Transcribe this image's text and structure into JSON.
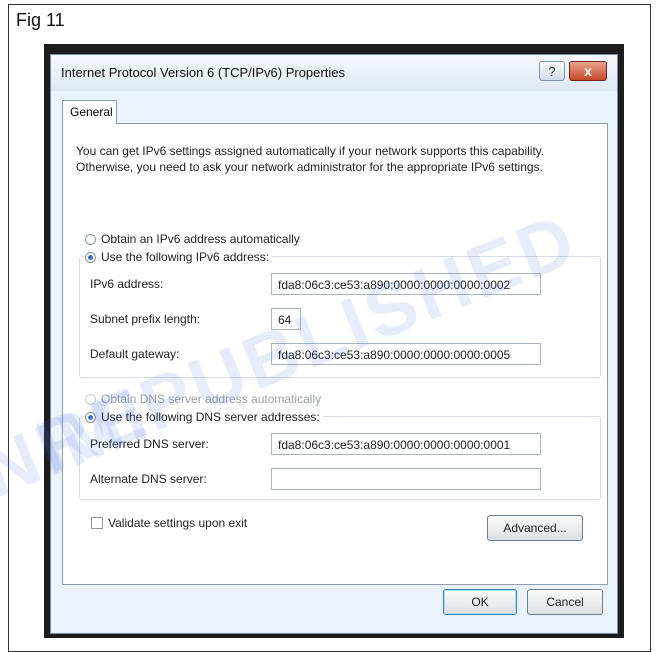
{
  "figure": {
    "label": "Fig 11"
  },
  "dialog": {
    "title": "Internet Protocol Version 6 (TCP/IPv6) Properties",
    "help_label": "?",
    "close_label": "x",
    "tab_general": "General",
    "intro": "You can get IPv6 settings assigned automatically if your network supports this capability. Otherwise, you need to ask your network administrator for the appropriate IPv6 settings.",
    "ip": {
      "auto_label": "Obtain an IPv6 address automatically",
      "manual_label": "Use the following IPv6 address:",
      "address_label": "IPv6 address:",
      "address_value": "fda8:06c3:ce53:a890:0000:0000:0000:0002",
      "prefix_label": "Subnet prefix length:",
      "prefix_value": "64",
      "gateway_label": "Default gateway:",
      "gateway_value": "fda8:06c3:ce53:a890:0000:0000:0000:0005"
    },
    "dns": {
      "auto_label": "Obtain DNS server address automatically",
      "manual_label": "Use the following DNS server addresses:",
      "preferred_label": "Preferred DNS server:",
      "preferred_value": "fda8:06c3:ce53:a890:0000:0000:0000:0001",
      "alternate_label": "Alternate DNS server:",
      "alternate_value": ""
    },
    "validate_label": "Validate settings upon exit",
    "advanced_button": "Advanced...",
    "ok_button": "OK",
    "cancel_button": "Cancel"
  },
  "watermark": {
    "line1": "NIMI",
    "line2": "REPUBLISHED"
  }
}
